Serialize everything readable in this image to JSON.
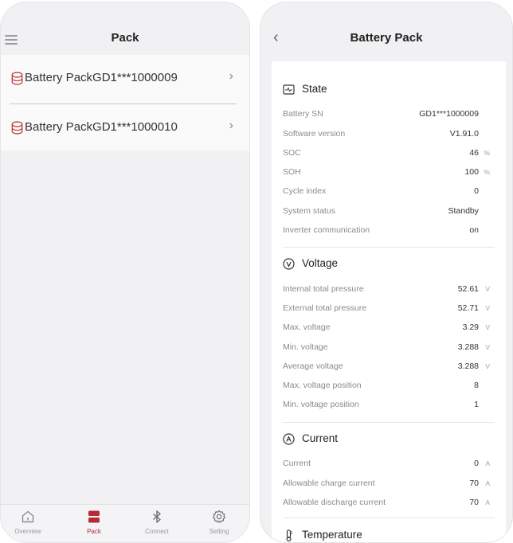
{
  "pack_list_screen": {
    "title": "Pack",
    "items": [
      {
        "label": "Battery PackGD1***1000009"
      },
      {
        "label": "Battery PackGD1***1000010"
      }
    ],
    "tabs": [
      {
        "label": "Overview",
        "icon": "home-icon"
      },
      {
        "label": "Pack",
        "icon": "battery-pack-icon",
        "active": true
      },
      {
        "label": "Connect",
        "icon": "bluetooth-icon"
      },
      {
        "label": "Setting",
        "icon": "gear-icon"
      }
    ]
  },
  "detail_screen": {
    "title": "Battery Pack",
    "state": {
      "title": "State",
      "rows": [
        {
          "label": "Battery SN",
          "value": "GD1***1000009",
          "unit": ""
        },
        {
          "label": "Software version",
          "value": "V1.91.0",
          "unit": ""
        },
        {
          "label": "SOC",
          "value": "46",
          "unit": "%"
        },
        {
          "label": "SOH",
          "value": "100",
          "unit": "%"
        },
        {
          "label": "Cycle index",
          "value": "0",
          "unit": ""
        },
        {
          "label": "System status",
          "value": "Standby",
          "unit": ""
        },
        {
          "label": "Inverter communication",
          "value": "on",
          "unit": ""
        }
      ]
    },
    "voltage": {
      "title": "Voltage",
      "rows": [
        {
          "label": "Internal total pressure",
          "value": "52.61",
          "unit": "V"
        },
        {
          "label": "External total pressure",
          "value": "52.71",
          "unit": "V"
        },
        {
          "label": "Max. voltage",
          "value": "3.29",
          "unit": "V"
        },
        {
          "label": "Min. voltage",
          "value": "3.288",
          "unit": "V"
        },
        {
          "label": "Average voltage",
          "value": "3.288",
          "unit": "V"
        },
        {
          "label": "Max. voltage position",
          "value": "8",
          "unit": ""
        },
        {
          "label": "Min. voltage position",
          "value": "1",
          "unit": ""
        }
      ]
    },
    "current": {
      "title": "Current",
      "rows": [
        {
          "label": "Current",
          "value": "0",
          "unit": "A"
        },
        {
          "label": "Allowable charge current",
          "value": "70",
          "unit": "A"
        },
        {
          "label": "Allowable discharge current",
          "value": "70",
          "unit": "A"
        }
      ]
    },
    "temperature": {
      "title": "Temperature"
    }
  },
  "colors": {
    "accent": "#b82a35",
    "background": "#f1f1f3",
    "card": "#ffffff"
  }
}
